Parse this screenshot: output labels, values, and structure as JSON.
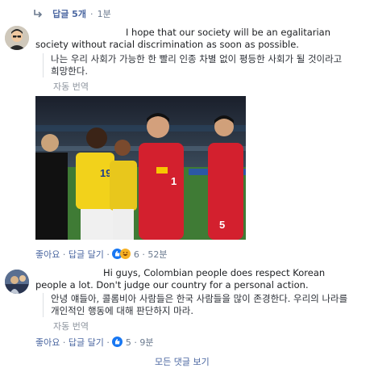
{
  "top_bar": {
    "replies_link": "답글 5개",
    "separator": "·",
    "time": "1분"
  },
  "comment1": {
    "text": "I hope that our society will be an egalitarian society without racial discrimination as soon as possible.",
    "translation": "나는 우리 사회가 가능한 한 빨리 인종 차별 없이 평등한 사회가 될 것이라고 희망한다.",
    "auto_translate": "자동 번역",
    "actions": {
      "like": "좋아요",
      "sep1": "·",
      "reply": "답글 달기",
      "sep2": "·",
      "reaction_count": "6",
      "sep3": "·",
      "time": "52분"
    }
  },
  "comment2": {
    "text": "Hi guys, Colombian people does respect Korean people a lot. Don't judge our country for a personal action.",
    "translation": "안녕 얘들아, 콜롬비아 사람들은 한국 사람들을 많이 존경한다. 우리의 나라를 개인적인 행동에 대해 판단하지 마라.",
    "auto_translate": "자동 번역",
    "actions": {
      "like": "좋아요",
      "sep1": "·",
      "reply": "답글 달기",
      "sep2": "·",
      "reaction_count": "5",
      "sep3": "·",
      "time": "9분"
    }
  },
  "bottom_cut": "모든 댓글 보기",
  "photo": {
    "jersey_numbers": [
      "19",
      "5",
      "1"
    ]
  },
  "colors": {
    "link": "#4b67a1",
    "meta": "#6b7a8f",
    "like_blue": "#1877f2",
    "haha_yellow": "#f7b125",
    "korea_red": "#d3202e",
    "colombia_yellow": "#f2d21b",
    "pitch_green": "#3f7b35"
  }
}
